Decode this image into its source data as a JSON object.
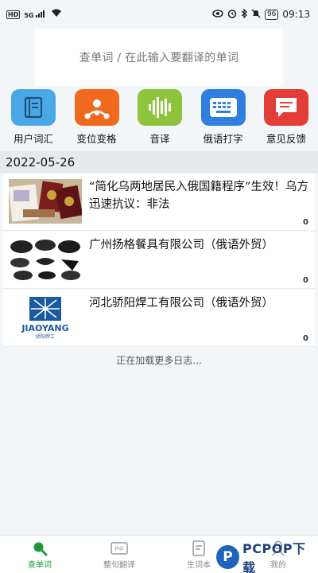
{
  "status_bar": {
    "hd": "HD",
    "signal": "5G",
    "battery": "96",
    "time": "09:13"
  },
  "search": {
    "placeholder": "查单词 / 在此输入要翻译的单词"
  },
  "tools": [
    {
      "label": "用户词汇",
      "icon": "vocabulary-book-icon",
      "color": "#4aa8e6"
    },
    {
      "label": "变位变格",
      "icon": "conjugation-network-icon",
      "color": "#ef6a1e"
    },
    {
      "label": "音译",
      "icon": "audio-wave-icon",
      "color": "#8cc43c"
    },
    {
      "label": "俄语打字",
      "icon": "keyboard-icon",
      "color": "#2e7fe0"
    },
    {
      "label": "意见反馈",
      "icon": "feedback-message-icon",
      "color": "#e23d37"
    }
  ],
  "date_header": "2022-05-26",
  "articles": [
    {
      "title": "“简化乌两地居民入俄国籍程序”生效！乌方迅速抗议：非法",
      "count": "0",
      "image": "passports-photo"
    },
    {
      "title": "广州扬格餐具有限公司（俄语外贸）",
      "count": "0",
      "image": "tableware-photo"
    },
    {
      "title": "河北骄阳焊工有限公司（俄语外贸）",
      "count": "0",
      "image": "jiaoyang-logo",
      "logo_text": "JIAOYANG",
      "logo_subtext": "骄阳焊工"
    }
  ],
  "loading_text": "正在加载更多日志...",
  "bottom_nav": [
    {
      "label": "查单词",
      "icon": "search-icon",
      "active": true
    },
    {
      "label": "整句翻译",
      "icon": "sentence-translate-icon",
      "active": false
    },
    {
      "label": "生词本",
      "icon": "notebook-icon",
      "active": false
    },
    {
      "label": "我的",
      "icon": "profile-icon",
      "active": false
    }
  ],
  "watermark": {
    "logo": "P",
    "text": "PCPOP下载"
  },
  "colors": {
    "accent_green": "#1a9a3c",
    "date_bar": "#e6eaee"
  }
}
